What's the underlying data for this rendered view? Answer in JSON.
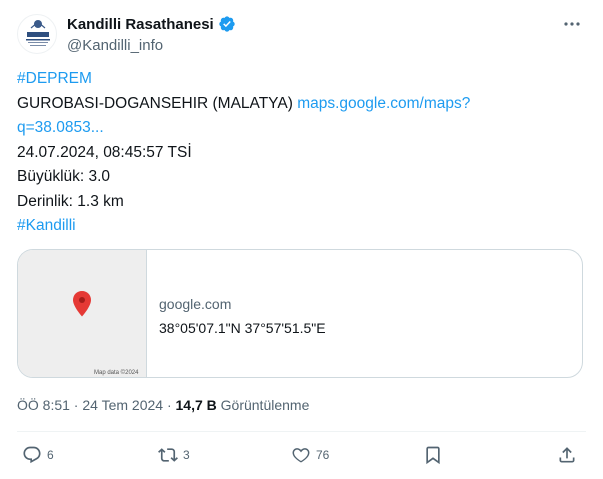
{
  "author": {
    "name": "Kandilli Rasathanesi",
    "handle": "@Kandilli_info",
    "avatar_text": "KANDILLI",
    "verified_color": "#1d9bf0"
  },
  "tweet": {
    "hashtag1": "#DEPREM",
    "location_text": "GUROBASI-DOGANSEHIR (MALATYA) ",
    "map_link_part1": "maps.google.com/maps?",
    "map_link_part2": "q=38.0853...",
    "datetime": "24.07.2024, 08:45:57 TSİ",
    "magnitude": "Büyüklük: 3.0",
    "depth": "Derinlik: 1.3 km",
    "hashtag2": "#Kandilli"
  },
  "card": {
    "domain": "google.com",
    "title": "38°05'07.1\"N 37°57'51.5\"E",
    "map_credit": "Map data ©2024",
    "pin_color": "#e53935"
  },
  "meta": {
    "time_date": "ÖÖ 8:51 · 24 Tem 2024 · ",
    "views_count": "14,7 B",
    "views_label": " Görüntülenme"
  },
  "actions": {
    "reply_count": "6",
    "retweet_count": "3",
    "like_count": "76"
  },
  "icons": [
    "more-icon",
    "verified-icon",
    "map-pin-icon",
    "reply-icon",
    "retweet-icon",
    "like-icon",
    "bookmark-icon",
    "share-icon"
  ],
  "colors": {
    "link": "#1d9bf0",
    "secondary_text": "#536471",
    "primary_text": "#0f1419",
    "border": "#cfd9de"
  }
}
